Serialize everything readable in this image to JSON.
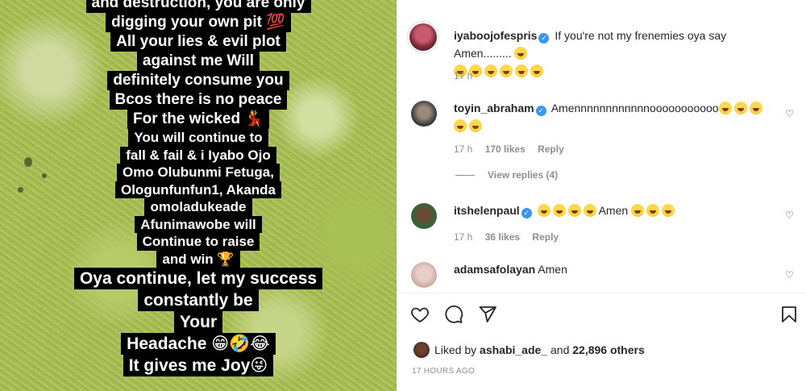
{
  "story": {
    "lines": [
      {
        "text": "and destruction, you are only",
        "size": "normal"
      },
      {
        "text": "digging your own pit 💯",
        "size": "normal"
      },
      {
        "text": "All your lies & evil plot",
        "size": "normal"
      },
      {
        "text": "against me Will",
        "size": "normal"
      },
      {
        "text": "definitely consume you",
        "size": "normal"
      },
      {
        "text": "Bcos there is no peace",
        "size": "normal"
      },
      {
        "text": "For the wicked 💃",
        "size": "normal"
      },
      {
        "text": "You will continue to",
        "size": "small"
      },
      {
        "text": "fall & fail & i Iyabo Ojo",
        "size": "small"
      },
      {
        "text": "Omo Olubunmi Fetuga,",
        "size": "small"
      },
      {
        "text": "Ologunfunfun1, Akanda",
        "size": "small"
      },
      {
        "text": "omoladukeade",
        "size": "small"
      },
      {
        "text": "Afunimawobe will",
        "size": "small"
      },
      {
        "text": "Continue to raise",
        "size": "small"
      },
      {
        "text": "and win 🏆",
        "size": "small"
      },
      {
        "text": "Oya continue, let my success",
        "size": "big"
      },
      {
        "text": "constantly be",
        "size": "big"
      },
      {
        "text": "Your",
        "size": "big"
      },
      {
        "text": "Headache 😁🤣😂",
        "size": "big"
      },
      {
        "text": "It gives me Joy😜",
        "size": "big"
      }
    ]
  },
  "post": {
    "author": "iyaboojofespris",
    "caption": "If you're not my frenemies oya say Amen.........",
    "time": "17 h"
  },
  "comments": [
    {
      "username": "toyin_abraham",
      "verified": true,
      "text": "Amennnnnnnnnnnnooooooooooo",
      "time": "17 h",
      "likes": "170 likes",
      "reply": "Reply",
      "view_replies": "View replies (4)"
    },
    {
      "username": "itshelenpaul",
      "verified": true,
      "text_middle": "Amen",
      "time": "17 h",
      "likes": "36 likes",
      "reply": "Reply"
    },
    {
      "username": "adamsafolayan",
      "verified": false,
      "text": "Amen"
    }
  ],
  "likes": {
    "prefix": "Liked by",
    "user": "ashabi_ade_",
    "and": "and",
    "others": "22,896 others"
  },
  "timestamp": "17 HOURS AGO",
  "icons": [
    "heart-icon",
    "comment-icon",
    "share-icon",
    "bookmark-icon",
    "verified-icon"
  ]
}
